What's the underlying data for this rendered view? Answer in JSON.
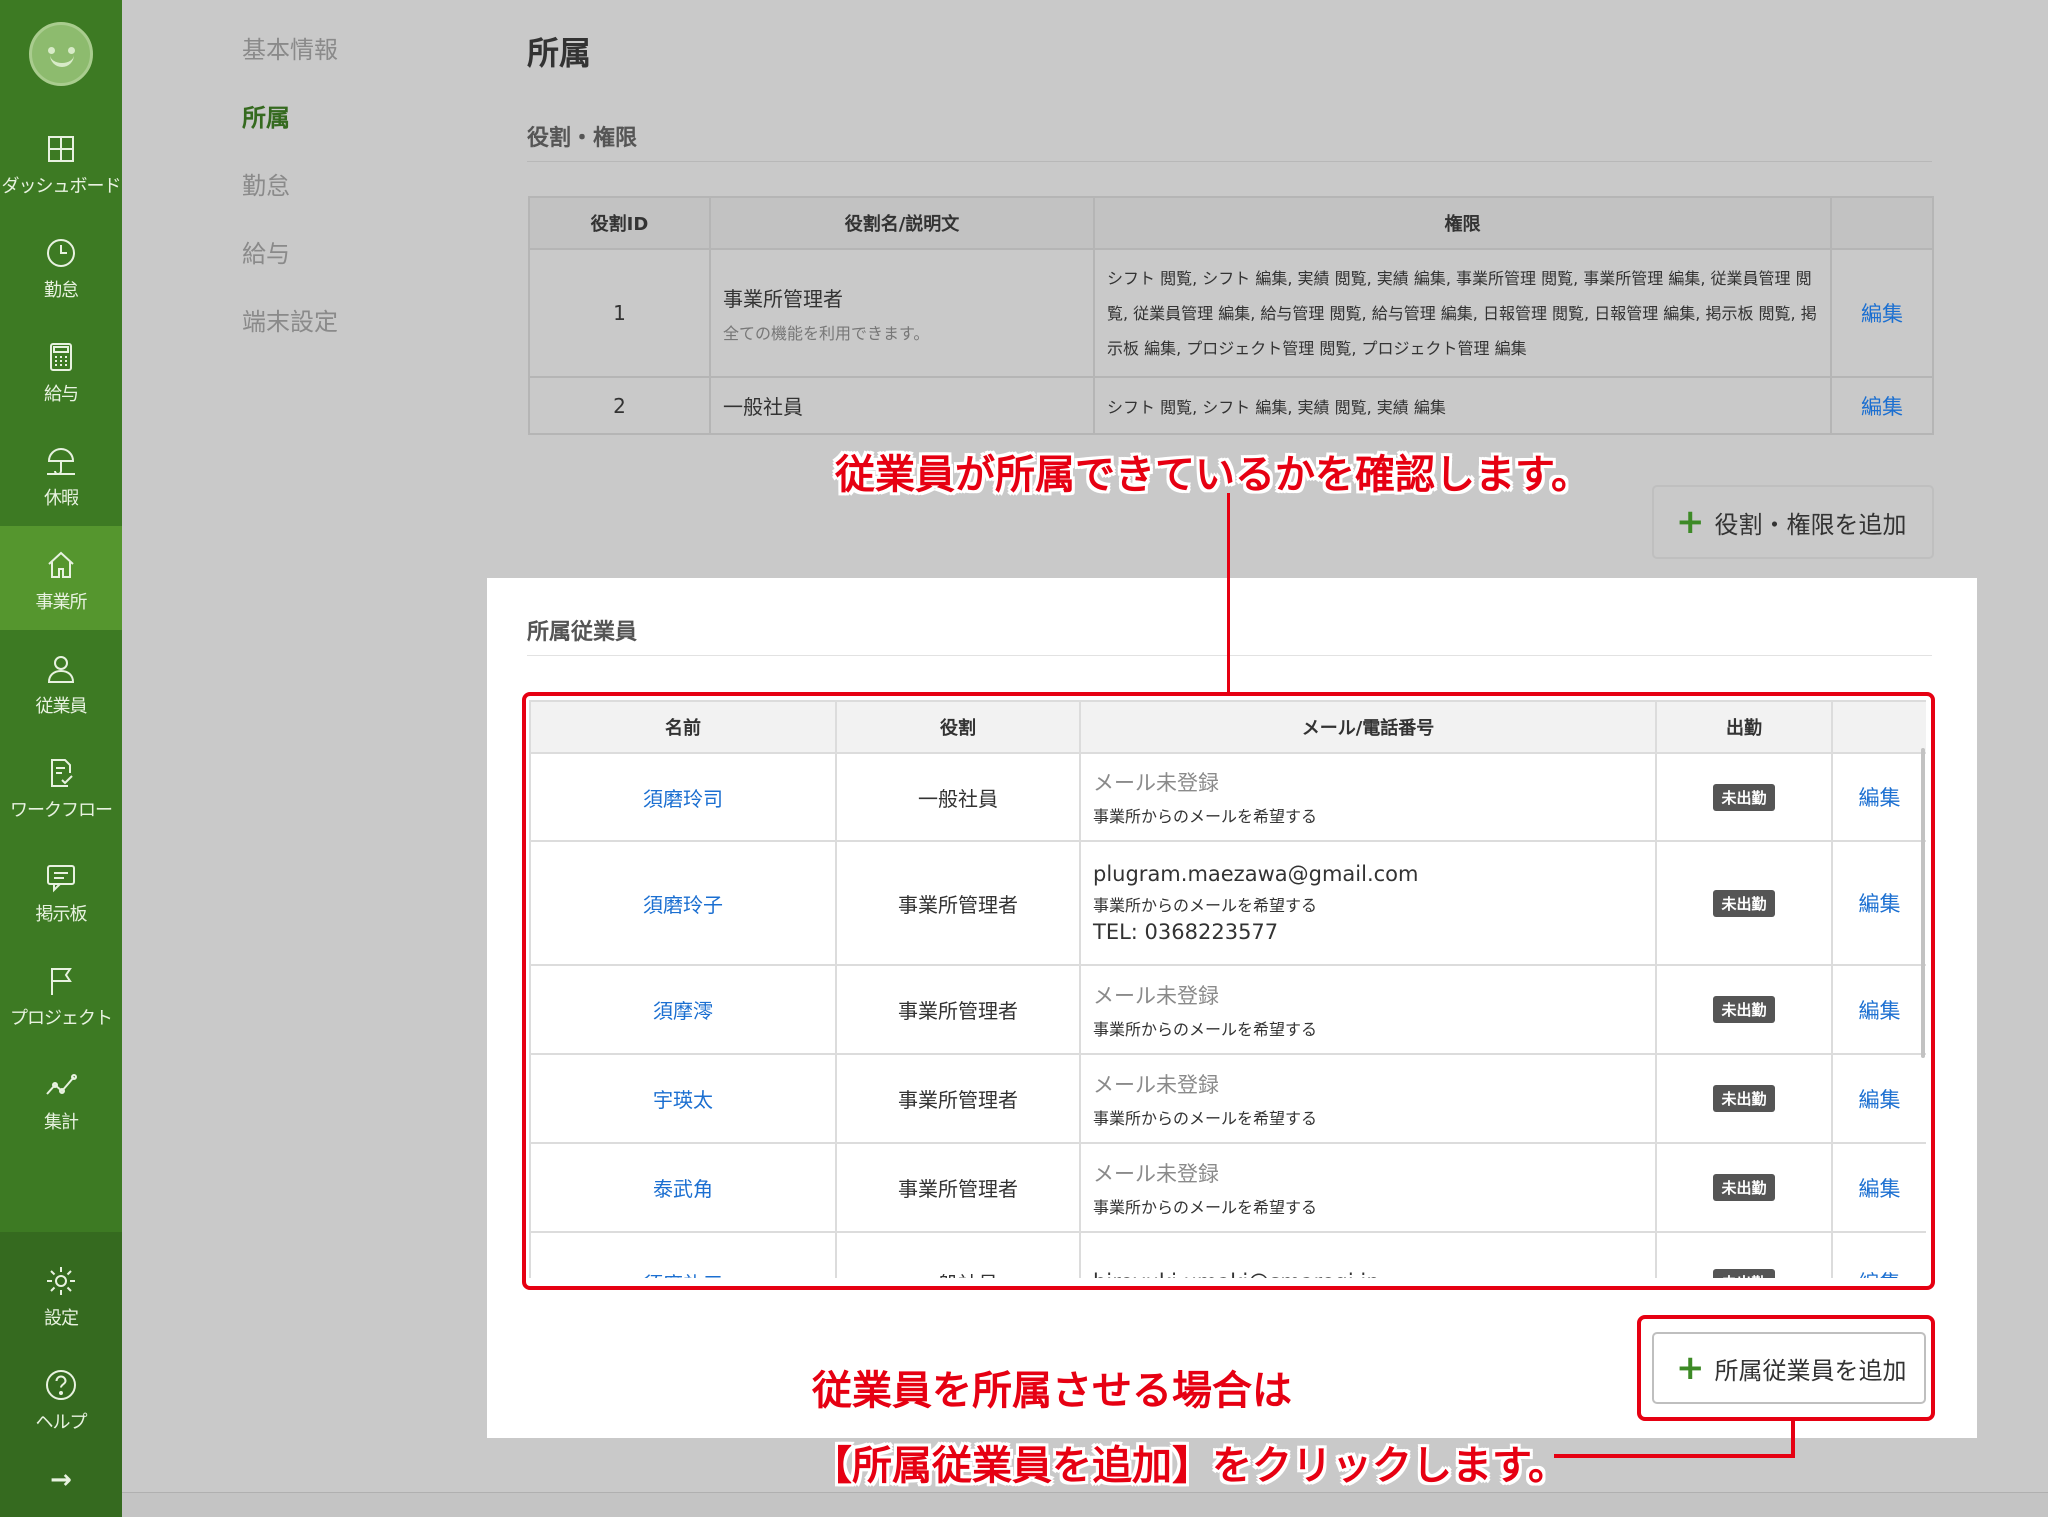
{
  "sidebar": {
    "items": [
      {
        "label": "ダッシュボード",
        "icon": "grid-icon"
      },
      {
        "label": "勤怠",
        "icon": "clock-icon"
      },
      {
        "label": "給与",
        "icon": "calculator-icon"
      },
      {
        "label": "休暇",
        "icon": "umbrella-icon"
      },
      {
        "label": "事業所",
        "icon": "home-icon"
      },
      {
        "label": "従業員",
        "icon": "person-icon"
      },
      {
        "label": "ワークフロー",
        "icon": "checklist-icon"
      },
      {
        "label": "掲示板",
        "icon": "message-icon"
      },
      {
        "label": "プロジェクト",
        "icon": "flag-icon"
      },
      {
        "label": "集計",
        "icon": "chart-icon"
      }
    ],
    "settings_label": "設定",
    "help_label": "ヘルプ",
    "expand_icon": "→"
  },
  "subnav": [
    "基本情報",
    "所属",
    "勤怠",
    "給与",
    "端末設定"
  ],
  "page_title": "所属",
  "roles": {
    "heading": "役割・権限",
    "headers": [
      "役割ID",
      "役割名/説明文",
      "権限",
      ""
    ],
    "rows": [
      {
        "id": "1",
        "name": "事業所管理者",
        "description": "全ての機能を利用できます。",
        "permissions": "シフト 閲覧, シフト 編集, 実績 閲覧, 実績 編集, 事業所管理 閲覧, 事業所管理 編集, 従業員管理 閲覧, 従業員管理 編集, 給与管理 閲覧, 給与管理 編集, 日報管理 閲覧, 日報管理 編集, 掲示板 閲覧, 掲示板 編集, プロジェクト管理 閲覧, プロジェクト管理 編集",
        "edit": "編集"
      },
      {
        "id": "2",
        "name": "一般社員",
        "description": "",
        "permissions": "シフト 閲覧, シフト 編集, 実績 閲覧, 実績 編集",
        "edit": "編集"
      }
    ],
    "add_button": "役割・権限を追加"
  },
  "employees": {
    "heading": "所属従業員",
    "headers": [
      "名前",
      "役割",
      "メール/電話番号",
      "出勤",
      ""
    ],
    "rows": [
      {
        "name": "須磨玲司",
        "role": "一般社員",
        "email": "メール未登録",
        "email_unregistered": true,
        "pref": "事業所からのメールを希望する",
        "tel": "",
        "status": "未出勤",
        "edit": "編集"
      },
      {
        "name": "須磨玲子",
        "role": "事業所管理者",
        "email": "plugram.maezawa@gmail.com",
        "email_unregistered": false,
        "pref": "事業所からのメールを希望する",
        "tel": "TEL: 0368223577",
        "status": "未出勤",
        "edit": "編集"
      },
      {
        "name": "須摩澪",
        "role": "事業所管理者",
        "email": "メール未登録",
        "email_unregistered": true,
        "pref": "事業所からのメールを希望する",
        "tel": "",
        "status": "未出勤",
        "edit": "編集"
      },
      {
        "name": "宇瑛太",
        "role": "事業所管理者",
        "email": "メール未登録",
        "email_unregistered": true,
        "pref": "事業所からのメールを希望する",
        "tel": "",
        "status": "未出勤",
        "edit": "編集"
      },
      {
        "name": "泰武角",
        "role": "事業所管理者",
        "email": "メール未登録",
        "email_unregistered": true,
        "pref": "事業所からのメールを希望する",
        "tel": "",
        "status": "未出勤",
        "edit": "編集"
      },
      {
        "name": "須磨礼三",
        "role": "一般社員",
        "email": "hiroyuki.umaki@smaregi.jp",
        "email_unregistered": false,
        "pref": "",
        "tel": "",
        "status": "未出勤",
        "edit": "編集"
      }
    ],
    "add_button": "所属従業員を追加"
  },
  "annotations": {
    "top": "従業員が所属できているかを確認します。",
    "bottom_line1": "従業員を所属させる場合は",
    "bottom_line2": "【所属従業員を追加】をクリックします。"
  },
  "colors": {
    "sidebar": "#3d7a23",
    "accent_green": "#356a1f",
    "link": "#1b6fd1",
    "annotation_red": "#e60012"
  }
}
